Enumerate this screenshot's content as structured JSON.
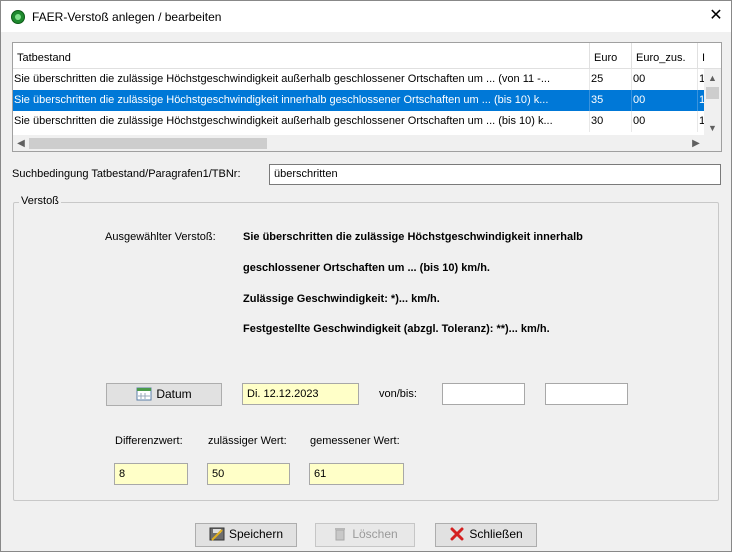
{
  "window": {
    "title": "FAER-Verstoß anlegen / bearbeiten",
    "close_glyph": "✕"
  },
  "grid": {
    "columns": [
      "Tatbestand",
      "Euro",
      "Euro_zus.",
      "I"
    ],
    "rows": [
      {
        "tatbestand": "Sie überschritten die zulässige Höchstgeschwindigkeit außerhalb geschlossener Ortschaften um ... (von 11 -...",
        "euro": "25",
        "euro_zus": "00",
        "extra": "1",
        "selected": false
      },
      {
        "tatbestand": "Sie überschritten die zulässige Höchstgeschwindigkeit innerhalb geschlossener Ortschaften um ... (bis 10) k...",
        "euro": "35",
        "euro_zus": "00",
        "extra": "1",
        "selected": true
      },
      {
        "tatbestand": "Sie überschritten die zulässige Höchstgeschwindigkeit außerhalb geschlossener Ortschaften um ... (bis 10) k...",
        "euro": "30",
        "euro_zus": "00",
        "extra": "1",
        "selected": false
      }
    ]
  },
  "search": {
    "label": "Suchbedingung Tatbestand/Paragrafen1/TBNr:",
    "value": "überschritten"
  },
  "verstoss": {
    "legend": "Verstoß",
    "selected_label": "Ausgewählter Verstoß:",
    "lines": [
      "Sie überschritten die zulässige Höchstgeschwindigkeit innerhalb",
      "geschlossener Ortschaften um ... (bis 10) km/h.",
      "Zulässige Geschwindigkeit: *)... km/h.",
      "Festgestellte Geschwindigkeit (abzgl. Toleranz): **)... km/h."
    ],
    "datum_button": "Datum",
    "datum_value": "Di. 12.12.2023",
    "von_bis_label": "von/bis:",
    "von_value": "",
    "bis_value": "",
    "differenz_label": "Differenzwert:",
    "differenz_value": "8",
    "zulaessig_label": "zulässiger Wert:",
    "zulaessig_value": "50",
    "gemessen_label": "gemessener Wert:",
    "gemessen_value": "61"
  },
  "buttons": {
    "save": "Speichern",
    "delete": "Löschen",
    "close": "Schließen"
  },
  "colors": {
    "selection": "#0078d7",
    "input_yellow": "#ffffc8"
  }
}
